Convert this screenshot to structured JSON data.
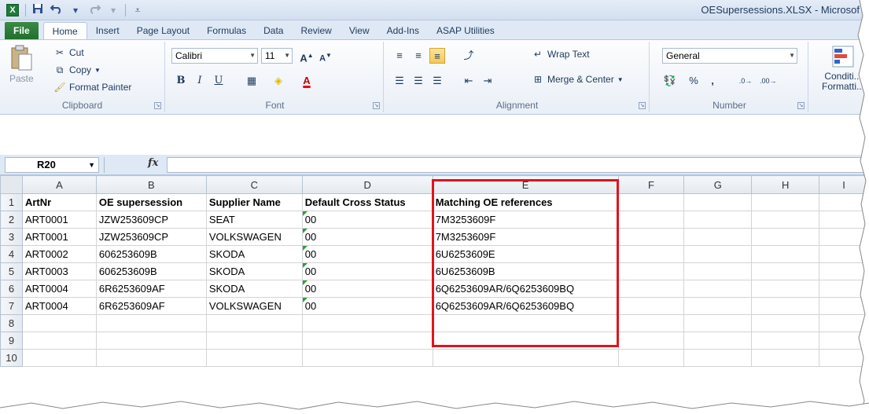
{
  "window": {
    "title": "OESupersessions.XLSX - Microsof",
    "app_icon": "X"
  },
  "qat": {
    "save_icon": "save-icon",
    "undo_icon": "undo-icon",
    "redo_icon": "redo-icon",
    "customize_icon": "customize-qat-icon"
  },
  "tabs": [
    "File",
    "Home",
    "Insert",
    "Page Layout",
    "Formulas",
    "Data",
    "Review",
    "View",
    "Add-Ins",
    "ASAP Utilities"
  ],
  "active_tab": "Home",
  "ribbon": {
    "clipboard": {
      "label": "Clipboard",
      "paste": "Paste",
      "cut": "Cut",
      "copy": "Copy",
      "format_painter": "Format Painter"
    },
    "font": {
      "label": "Font",
      "font_name": "Calibri",
      "font_size": "11",
      "bold": "B",
      "italic": "I",
      "underline": "U"
    },
    "alignment": {
      "label": "Alignment",
      "wrap_text": "Wrap Text",
      "merge_center": "Merge & Center"
    },
    "number": {
      "label": "Number",
      "format": "General",
      "percent": "%",
      "comma": ","
    },
    "styles": {
      "conditional_formatting": "Conditi... Formatti..."
    }
  },
  "formula_bar": {
    "name_box": "R20",
    "fx_label": "fx",
    "formula": ""
  },
  "grid": {
    "columns": [
      "A",
      "B",
      "C",
      "D",
      "E",
      "F",
      "G",
      "H",
      "I"
    ],
    "rows": [
      {
        "num": "1",
        "cells": [
          "ArtNr",
          "OE supersession",
          "Supplier Name",
          "Default Cross Status",
          "Matching OE references"
        ]
      },
      {
        "num": "2",
        "cells": [
          "ART0001",
          "JZW253609CP",
          "SEAT",
          "00",
          "7M3253609F"
        ]
      },
      {
        "num": "3",
        "cells": [
          "ART0001",
          "JZW253609CP",
          "VOLKSWAGEN",
          "00",
          "7M3253609F"
        ]
      },
      {
        "num": "4",
        "cells": [
          "ART0002",
          "606253609B",
          "SKODA",
          "00",
          "6U6253609E"
        ]
      },
      {
        "num": "5",
        "cells": [
          "ART0003",
          "606253609B",
          "SKODA",
          "00",
          "6U6253609B"
        ]
      },
      {
        "num": "6",
        "cells": [
          "ART0004",
          "6R6253609AF",
          "SKODA",
          "00",
          "6Q6253609AR/6Q6253609BQ"
        ]
      },
      {
        "num": "7",
        "cells": [
          "ART0004",
          "6R6253609AF",
          "VOLKSWAGEN",
          "00",
          "6Q6253609AR/6Q6253609BQ"
        ]
      },
      {
        "num": "8",
        "cells": [
          "",
          "",
          "",
          "",
          ""
        ]
      },
      {
        "num": "9",
        "cells": [
          "",
          "",
          "",
          "",
          ""
        ]
      },
      {
        "num": "10",
        "cells": [
          "",
          "",
          "",
          "",
          ""
        ]
      }
    ]
  },
  "colors": {
    "highlight": "#e3131a",
    "file_tab": "#2d7d3a",
    "text_indicator": "#2e9e3f"
  }
}
